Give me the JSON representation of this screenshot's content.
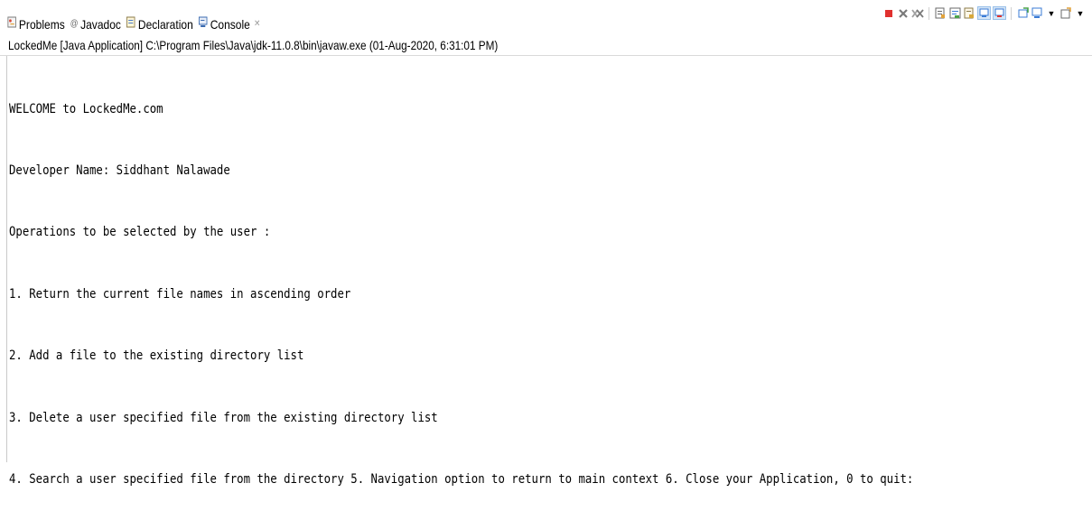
{
  "tabs": [
    {
      "label": "Problems",
      "icon": "problems-icon"
    },
    {
      "label": "Javadoc",
      "icon": "javadoc-icon"
    },
    {
      "label": "Declaration",
      "icon": "declaration-icon"
    },
    {
      "label": "Console",
      "icon": "console-icon",
      "active": true,
      "close_glyph": "✕"
    }
  ],
  "toolbar": {
    "icons": [
      "terminate-icon",
      "remove-launch-icon",
      "remove-all-terminated-icon",
      "scroll-lock-icon",
      "word-wrap-icon",
      "show-console-on-stdout-icon",
      "show-console-on-stderr-icon",
      "pin-console-icon",
      "display-selected-console-icon",
      "open-console-icon"
    ],
    "colors": {
      "terminate": "#e0302e",
      "blue": "#3a7bd5",
      "pressed_bg": "#d6e6f7"
    }
  },
  "launch_label": "LockedMe [Java Application] C:\\Program Files\\Java\\jdk-11.0.8\\bin\\javaw.exe  (01-Aug-2020, 6:31:01 PM)",
  "console_lines": [
    "WELCOME to LockedMe.com",
    "Developer Name: Siddhant Nalawade",
    "Operations to be selected by the user :",
    "1. Return the current file names in ascending order",
    "2. Add a file to the existing directory list",
    "3. Delete a user specified file from the existing directory list",
    "4. Search a user specified file from the directory 5. Navigation option to return to main context 6. Close your Application, 0 to quit:"
  ]
}
